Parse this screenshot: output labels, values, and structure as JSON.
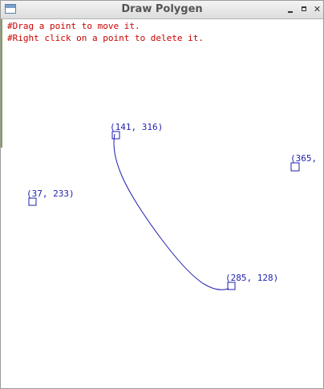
{
  "window": {
    "title": "Draw Polygen"
  },
  "instructions": [
    "#Drag a point to move it.",
    "#Right click on a point to delete it."
  ],
  "colors": {
    "instruction_text": "#cc0000",
    "point": "#1f1fb0",
    "curve": "#1f1fb0",
    "background": "#ffffff"
  },
  "points": [
    {
      "label": "(141, 316)"
    },
    {
      "label": "(285, 128)"
    },
    {
      "label": "(37, 233)"
    },
    {
      "label": "(365,"
    }
  ],
  "icons": {
    "app": "window-icon",
    "minimize": "minimize-icon",
    "maximize": "maximize-icon",
    "close": "close-icon"
  }
}
